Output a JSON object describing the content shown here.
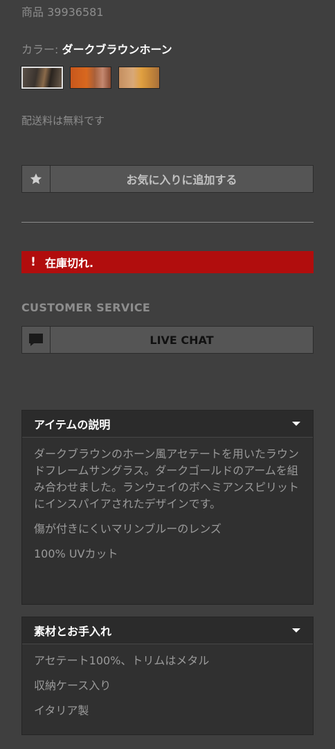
{
  "product": {
    "sku_label": "商品 39936581",
    "color_label": "カラー: ",
    "color_value": "ダークブラウンホーン",
    "swatches": [
      {
        "name": "ダークブラウンホーン",
        "selected": true
      },
      {
        "name": "orange-tortoise",
        "selected": false
      },
      {
        "name": "honey-tortoise",
        "selected": false
      }
    ],
    "shipping_text": "配送料は無料です"
  },
  "favorite": {
    "icon": "star-icon",
    "label": "お気に入りに追加する"
  },
  "stock_status": {
    "icon": "!",
    "text": "在庫切れ.",
    "color": "#b10d0d"
  },
  "customer_service": {
    "title": "CUSTOMER SERVICE",
    "chat_icon": "chat-bubble-icon",
    "chat_label": "LIVE CHAT"
  },
  "accordions": [
    {
      "title": "アイテムの説明",
      "icon": "chevron-down-icon",
      "paragraphs": [
        "ダークブラウンのホーン風アセテートを用いたラウンドフレームサングラス。ダークゴールドのアームを組み合わせました。ランウェイのボヘミアンスピリットにインスパイアされたデザインです。",
        "傷が付きにくいマリンブルーのレンズ",
        "100% UVカット"
      ]
    },
    {
      "title": "素材とお手入れ",
      "icon": "chevron-down-icon",
      "paragraphs": [
        "アセテート100%、トリムはメタル",
        "収納ケース入り",
        "イタリア製"
      ]
    }
  ]
}
